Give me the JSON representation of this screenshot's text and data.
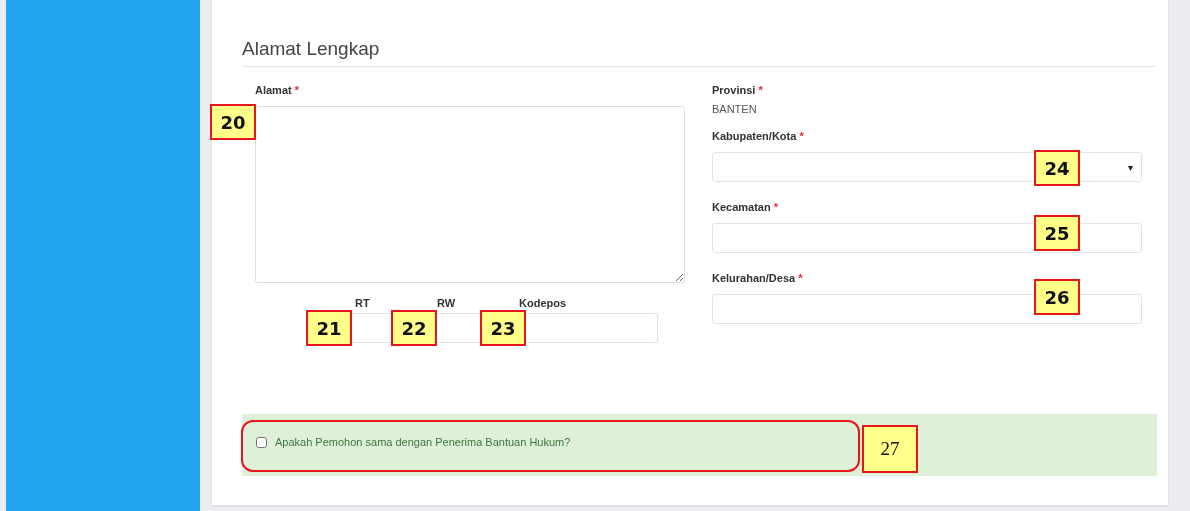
{
  "section": {
    "title": "Alamat Lengkap"
  },
  "address": {
    "label": "Alamat",
    "required_mark": "*",
    "callout": "20"
  },
  "small_fields": [
    {
      "label": "RT",
      "callout": "21"
    },
    {
      "label": "RW",
      "callout": "22"
    },
    {
      "label": "Kodepos",
      "callout": "23"
    }
  ],
  "province": {
    "label": "Provinsi",
    "required_mark": "*",
    "value": "BANTEN"
  },
  "right_fields": [
    {
      "label": "Kabupaten/Kota",
      "required_mark": "*",
      "kind": "select",
      "caret": "▾",
      "callout": "24"
    },
    {
      "label": "Kecamatan",
      "required_mark": "*",
      "kind": "text",
      "callout": "25"
    },
    {
      "label": "Kelurahan/Desa",
      "required_mark": "*",
      "kind": "text",
      "callout": "26"
    }
  ],
  "notice": {
    "label": "Apakah Pemohon sama dengan Penerima Bantuan Hukum?",
    "checked": false,
    "callout": "27"
  }
}
